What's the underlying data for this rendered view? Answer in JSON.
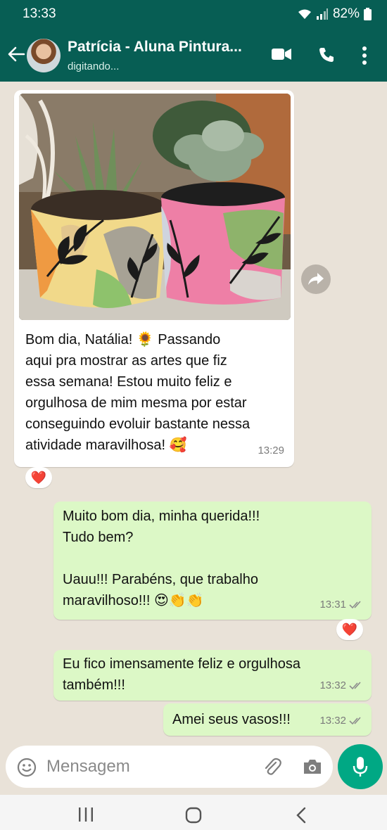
{
  "status_bar": {
    "time": "13:33",
    "battery": "82%"
  },
  "header": {
    "contact_name": "Patrícia - Aluna Pintura...",
    "contact_status": "digitando..."
  },
  "messages": [
    {
      "direction": "incoming",
      "has_image": true,
      "lines": [
        "Bom dia, Natália! 🌻  Passando",
        "aqui pra mostrar as artes que fiz",
        "essa semana!  Estou muito feliz e",
        "orgulhosa de mim mesma por estar",
        "conseguindo evoluir bastante nessa",
        "atividade maravilhosa! 🥰"
      ],
      "time": "13:29",
      "reaction": "❤️"
    },
    {
      "direction": "outgoing",
      "lines": [
        "Muito bom dia, minha querida!!!",
        "Tudo bem?",
        "",
        "Uauu!!! Parabéns, que trabalho",
        "maravilhoso!!! 😍👏👏"
      ],
      "time": "13:31",
      "reaction": "❤️"
    },
    {
      "direction": "outgoing",
      "lines": [
        "Eu fico imensamente feliz  e orgulhosa",
        "também!!!"
      ],
      "time": "13:32"
    },
    {
      "direction": "outgoing",
      "lines": [
        "Amei seus vasos!!!"
      ],
      "time": "13:32"
    }
  ],
  "composer": {
    "placeholder": "Mensagem"
  },
  "colors": {
    "header": "#075e54",
    "chat_background": "#e9e2d8",
    "incoming_bubble": "#ffffff",
    "outgoing_bubble": "#dcf8c6",
    "mic_button": "#00a884"
  },
  "icons": {
    "header": [
      "back-arrow-icon",
      "video-call-icon",
      "phone-icon",
      "more-vert-icon"
    ],
    "composer": [
      "emoji-icon",
      "attach-icon",
      "camera-icon",
      "mic-icon"
    ],
    "navbar": [
      "recent-apps-icon",
      "home-icon",
      "back-icon"
    ]
  }
}
